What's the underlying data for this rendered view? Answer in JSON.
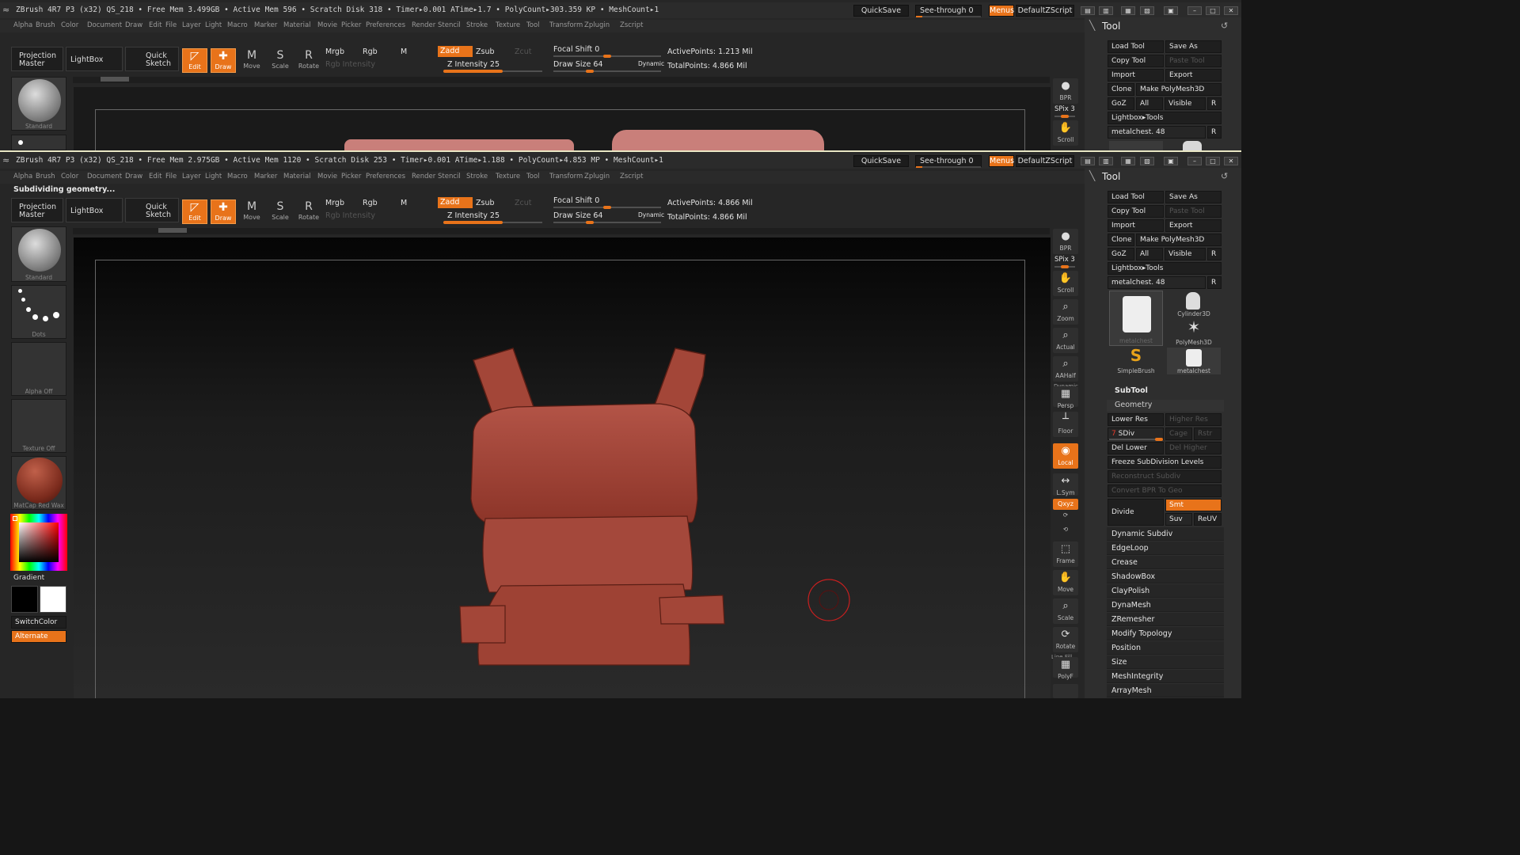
{
  "title_top": "ZBrush 4R7 P3 (x32)   QS_218   • Free Mem 3.499GB • Active Mem 596 • Scratch Disk 318 •  Timer▸0.001  ATime▸1.7 • PolyCount▸303.359 KP  • MeshCount▸1",
  "title_bottom": "ZBrush 4R7 P3 (x32)   QS_218   • Free Mem 2.975GB • Active Mem 1120 • Scratch Disk 253 •  Timer▸0.001  ATime▸1.188 • PolyCount▸4.853 MP  • MeshCount▸1",
  "titlebar": {
    "quicksave": "QuickSave",
    "see_through": "See-through  0",
    "menus": "Menus",
    "script": "DefaultZScript",
    "see_through_level": 0.1
  },
  "menus": [
    "Alpha",
    "Brush",
    "Color",
    "Document",
    "Draw",
    "Edit",
    "File",
    "Layer",
    "Light",
    "Macro",
    "Marker",
    "Material",
    "Movie",
    "Picker",
    "Preferences",
    "Render",
    "Stencil",
    "Stroke",
    "Texture",
    "Tool",
    "Transform",
    "Zplugin",
    "Zscript"
  ],
  "status_message": "Subdividing geometry...",
  "shelf": {
    "projection_master": "Projection Master",
    "lightbox": "LightBox",
    "quick_sketch": "Quick Sketch",
    "edit": "Edit",
    "draw": "Draw",
    "move": "Move",
    "scale": "Scale",
    "rotate": "Rotate",
    "mrgb": "Mrgb",
    "rgb": "Rgb",
    "m": "M",
    "zadd": "Zadd",
    "zsub": "Zsub",
    "zcut": "Zcut",
    "rgb_intensity": "Rgb  Intensity",
    "z_intensity": "Z Intensity 25",
    "focal_shift": "Focal Shift 0",
    "draw_size": "Draw Size 64",
    "dynamic": "Dynamic",
    "active_points_top": "ActivePoints: 1.213  Mil",
    "active_points_bottom": "ActivePoints: 4.866  Mil",
    "total_points": "TotalPoints: 4.866  Mil",
    "z_intensity_level": 0.25,
    "focal_shift_level": 0.5,
    "draw_size_level": 0.3
  },
  "left": {
    "brush": "Standard",
    "stroke": "Dots",
    "alpha": "Alpha  Off",
    "texture": "Texture  Off",
    "material": "MatCap  Red  Wax",
    "gradient": "Gradient",
    "switch_color": "SwitchColor",
    "alternate": "Alternate"
  },
  "right_strip": {
    "bpr": "BPR",
    "spix": "SPix 3",
    "scroll": "Scroll",
    "zoom": "Zoom",
    "actual": "Actual",
    "aahalf": "AAHalf",
    "dynamic": "Dynamic",
    "persp": "Persp",
    "floor": "Floor",
    "local": "Local",
    "lsym": "L.Sym",
    "xyz": "Qxyz",
    "frame": "Frame",
    "move": "Move",
    "scale": "Scale",
    "rotate": "Rotate",
    "linefill": "Line Fill",
    "polyf": "PolyF"
  },
  "tool_panel": {
    "title": "Tool",
    "load_tool": "Load Tool",
    "save_as": "Save As",
    "copy_tool": "Copy Tool",
    "paste_tool": "Paste Tool",
    "import": "Import",
    "export": "Export",
    "clone": "Clone",
    "make_polymesh": "Make PolyMesh3D",
    "goz": "GoZ",
    "all": "All",
    "visible": "Visible",
    "r": "R",
    "lightbox_tools": "Lightbox▸Tools",
    "current_tool": "metalchest. 48",
    "thumbs": [
      "metalchest",
      "Cylinder3D",
      "PolyMesh3D",
      "SimpleBrush",
      "metalchest"
    ],
    "subtool": "SubTool",
    "geometry": "Geometry",
    "lower_res": "Lower Res",
    "higher_res": "Higher Res",
    "sdiv": "SDiv",
    "sdiv_value": "7",
    "cage": "Cage",
    "rstr": "Rstr",
    "del_lower": "Del Lower",
    "del_higher": "Del Higher",
    "freeze": "Freeze SubDivision Levels",
    "reconstruct": "Reconstruct Subdiv",
    "convert_bpr": "Convert BPR To Geo",
    "divide": "Divide",
    "smt": "Smt",
    "suv": "Suv",
    "reuv": "ReUV",
    "sections": [
      "Dynamic Subdiv",
      "EdgeLoop",
      "Crease",
      "ShadowBox",
      "ClayPolish",
      "DynaMesh",
      "ZRemesher",
      "Modify Topology",
      "Position",
      "Size",
      "MeshIntegrity",
      "ArrayMesh"
    ]
  },
  "colors": {
    "accent": "#e8731a",
    "model": "#a8483a",
    "model_top": "#c97f7a"
  }
}
